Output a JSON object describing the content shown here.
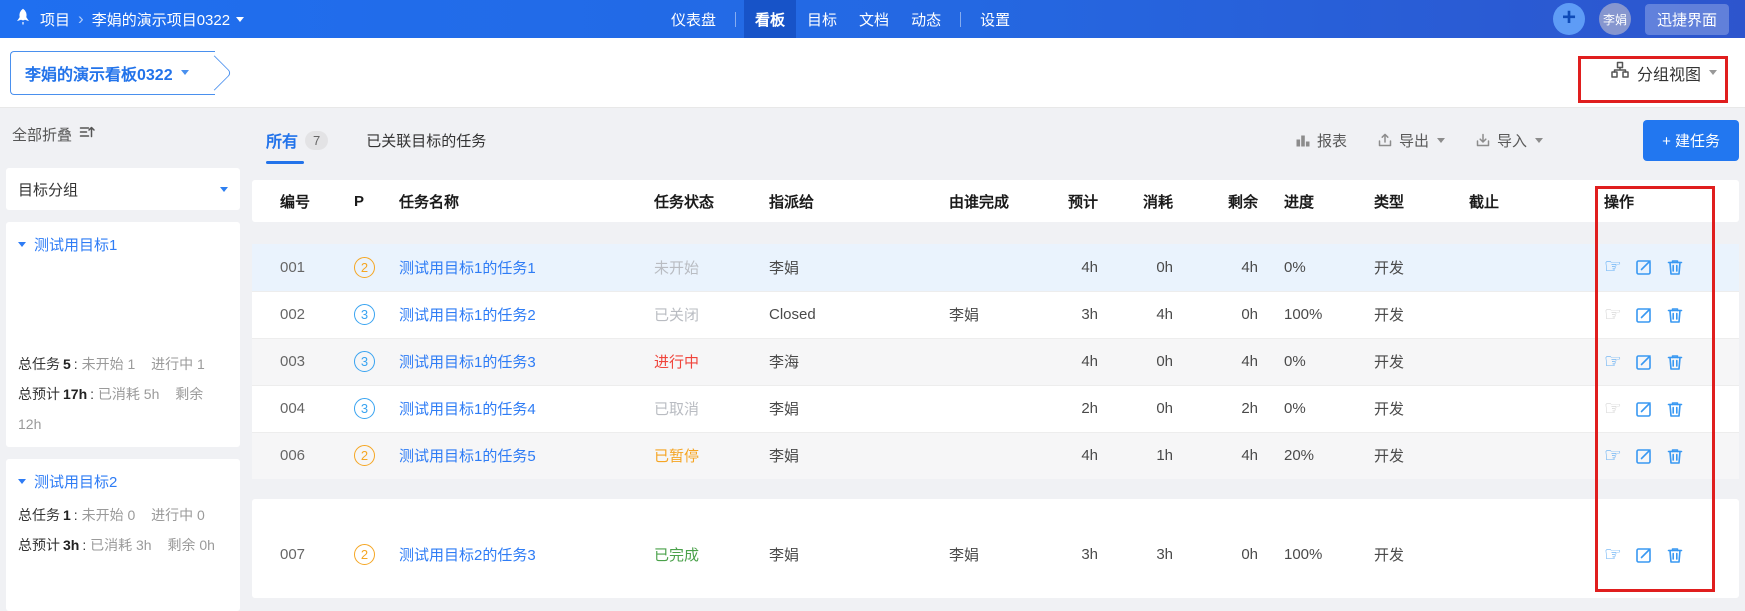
{
  "topbar": {
    "app_label": "项目",
    "project_name": "李娟的演示项目0322",
    "nav": [
      {
        "label": "仪表盘"
      },
      {
        "label": "看板"
      },
      {
        "label": "目标"
      },
      {
        "label": "文档"
      },
      {
        "label": "动态"
      },
      {
        "label": "设置"
      }
    ],
    "user_avatar": "李娟",
    "skin_button": "迅捷界面"
  },
  "subheader": {
    "board_name": "李娟的演示看板0322",
    "view_mode": "分组视图"
  },
  "sidebar": {
    "collapse_all": "全部折叠",
    "group_filter": "目标分组",
    "groups": [
      {
        "name": "测试用目标1",
        "stats": {
          "total_label": "总任务",
          "total": "5",
          "colon": ":",
          "not_started_label": "未开始",
          "not_started": "1",
          "doing_label": "进行中",
          "doing": "1",
          "estimate_label": "总预计",
          "estimate": "17h",
          "consumed_label": "已消耗",
          "consumed": "5h",
          "remain_label": "剩余",
          "remain": "12h"
        }
      },
      {
        "name": "测试用目标2",
        "stats": {
          "total_label": "总任务",
          "total": "1",
          "colon": ":",
          "not_started_label": "未开始",
          "not_started": "0",
          "doing_label": "进行中",
          "doing": "0",
          "estimate_label": "总预计",
          "estimate": "3h",
          "consumed_label": "已消耗",
          "consumed": "3h",
          "remain_label": "剩余",
          "remain": "0h"
        }
      }
    ]
  },
  "toolbar": {
    "tab_all": "所有",
    "tab_all_count": "7",
    "tab_linked": "已关联目标的任务",
    "report": "报表",
    "export": "导出",
    "import": "导入",
    "create_task": "+ 建任务"
  },
  "table": {
    "columns": [
      "编号",
      "P",
      "任务名称",
      "任务状态",
      "指派给",
      "由谁完成",
      "预计",
      "消耗",
      "剩余",
      "进度",
      "类型",
      "截止",
      "操作"
    ],
    "groups": [
      {
        "rows": [
          {
            "id": "001",
            "priority": "2",
            "name": "测试用目标1的任务1",
            "status": "未开始",
            "assigned_to": "李娟",
            "finished_by": "",
            "estimate": "4h",
            "consumed": "0h",
            "remain": "4h",
            "progress": "0%",
            "type": "开发",
            "deadline": ""
          },
          {
            "id": "002",
            "priority": "3",
            "name": "测试用目标1的任务2",
            "status": "已关闭",
            "assigned_to": "Closed",
            "finished_by": "李娟",
            "estimate": "3h",
            "consumed": "4h",
            "remain": "0h",
            "progress": "100%",
            "type": "开发",
            "deadline": ""
          },
          {
            "id": "003",
            "priority": "3",
            "name": "测试用目标1的任务3",
            "status": "进行中",
            "assigned_to": "李海",
            "finished_by": "",
            "estimate": "4h",
            "consumed": "0h",
            "remain": "4h",
            "progress": "0%",
            "type": "开发",
            "deadline": ""
          },
          {
            "id": "004",
            "priority": "3",
            "name": "测试用目标1的任务4",
            "status": "已取消",
            "assigned_to": "李娟",
            "finished_by": "",
            "estimate": "2h",
            "consumed": "0h",
            "remain": "2h",
            "progress": "0%",
            "type": "开发",
            "deadline": ""
          },
          {
            "id": "006",
            "priority": "2",
            "name": "测试用目标1的任务5",
            "status": "已暂停",
            "assigned_to": "李娟",
            "finished_by": "",
            "estimate": "4h",
            "consumed": "1h",
            "remain": "4h",
            "progress": "20%",
            "type": "开发",
            "deadline": ""
          }
        ]
      },
      {
        "rows": [
          {
            "id": "007",
            "priority": "2",
            "name": "测试用目标2的任务3",
            "status": "已完成",
            "assigned_to": "李娟",
            "finished_by": "李娟",
            "estimate": "3h",
            "consumed": "3h",
            "remain": "0h",
            "progress": "100%",
            "type": "开发",
            "deadline": ""
          }
        ]
      }
    ]
  },
  "colors": {
    "topbar_blue": "#2173ea",
    "accent_blue": "#2e7cf5",
    "status_doing_red": "#f0443b",
    "status_paused_orange": "#f5a524",
    "status_done_green": "#4aa14a",
    "status_inactive_gray": "#b9bcc2",
    "priority_orange": "#f5a623",
    "priority_blue": "#38a3f1",
    "create_button_blue": "#2277f0",
    "annotation_red": "#e01e1e"
  }
}
